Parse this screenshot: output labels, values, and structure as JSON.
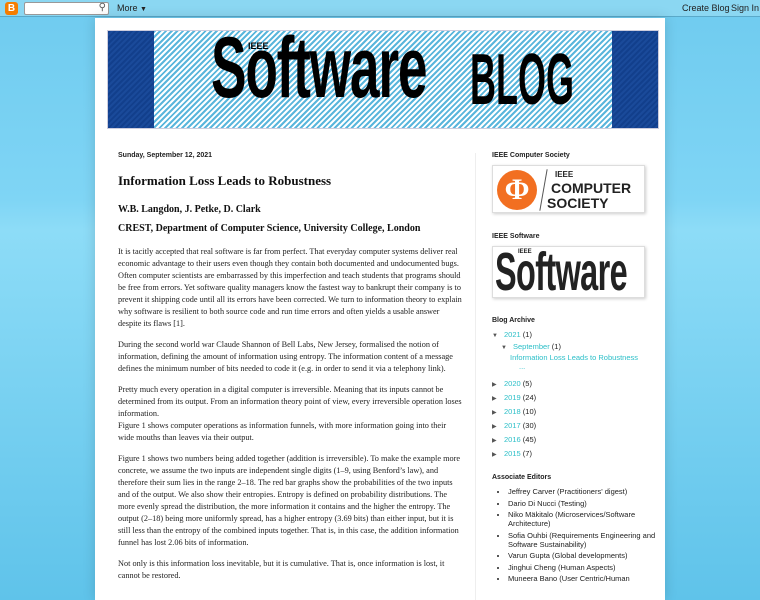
{
  "navbar": {
    "more": "More",
    "create_blog": "Create Blog",
    "sign_in": "Sign In",
    "search_placeholder": ""
  },
  "banner": {
    "ieee": "IEEE",
    "software": "Software",
    "blog": "BLOG",
    "colors": {
      "dark": "#123f8c",
      "stripe": "#5ab6dc"
    }
  },
  "post": {
    "date": "Sunday, September 12, 2021",
    "title": "Information Loss Leads to Robustness",
    "authors": "W.B. Langdon, J. Petke, D. Clark",
    "affiliation": "CREST, Department of Computer Science, University College, London",
    "paragraphs": [
      "It is tacitly accepted that real software is far from perfect. That everyday computer systems deliver real economic advantage to their users even though they contain both documented and undocumented bugs. Often computer scientists are embarrassed by this imperfection and teach students that programs should be free from errors. Yet software quality managers know the fastest way to bankrupt their company is to prevent it shipping code until all its errors have been corrected. We turn to information theory to explain why software is resilient to both source code and run time errors and often yields a usable answer despite its flaws [1].",
      "During the second world war Claude Shannon of Bell Labs, New Jersey, formalised the notion of information, defining the amount of information using entropy. The information content of a message defines the minimum number of bits needed to code it (e.g. in order to send it via a telephony link).",
      "Pretty much every operation in a digital computer is irreversible. Meaning that its inputs cannot be determined from its output. From an information theory point of view, every irreversible operation loses information.",
      "Figure 1 shows computer operations as information funnels, with more information going into their wide mouths than leaves via their output.",
      "Figure 1 shows two numbers being added together (addition is irreversible). To make the example more concrete, we assume the two inputs are independent single digits (1–9, using Benford’s law), and therefore their sum lies in the range 2–18. The red bar graphs show the probabilities of the two inputs and of the output. We also show their entropies. Entropy is defined on probability distributions. The more evenly spread the distribution, the more information it contains and the higher the entropy. The output (2–18) being more uniformly spread, has a higher entropy (3.69 bits) than either input, but it is still less than the entropy of the combined inputs together. That is, in this case, the addition information funnel has lost 2.06 bits of information.",
      "Not only is this information loss inevitable, but it is cumulative. That is, once information is lost, it cannot be restored."
    ]
  },
  "sidebar": {
    "cs_title": "IEEE Computer Society",
    "cs_logo": {
      "ieee": "IEEE",
      "computer": "COMPUTER",
      "society": "SOCIETY",
      "color": "#f26f21"
    },
    "sw_title": "IEEE Software",
    "sw_logo": {
      "ieee": "IEEE",
      "software": "Software"
    },
    "archive_title": "Blog Archive",
    "archive": {
      "open_year": {
        "label": "2021",
        "count": "(1)"
      },
      "open_month": {
        "label": "September",
        "count": "(1)"
      },
      "post": "Information Loss Leads to Robustness",
      "ellipsis": "...",
      "years": [
        {
          "label": "2020",
          "count": "(5)"
        },
        {
          "label": "2019",
          "count": "(24)"
        },
        {
          "label": "2018",
          "count": "(10)"
        },
        {
          "label": "2017",
          "count": "(30)"
        },
        {
          "label": "2016",
          "count": "(45)"
        },
        {
          "label": "2015",
          "count": "(7)"
        }
      ]
    },
    "editors_title": "Associate Editors",
    "editors": [
      "Jeffrey Carver (Practitioners' digest)",
      "Dario Di Nucci (Testing)",
      "Niko Mäkitalo (Microservices/Software Architecture)",
      "Sofia Ouhbi (Requirements Engineering and Software Sustainability)",
      "Varun Gupta (Global developments)",
      "Jinghui Cheng (Human Aspects)",
      "Muneera Bano (User Centric/Human"
    ]
  }
}
